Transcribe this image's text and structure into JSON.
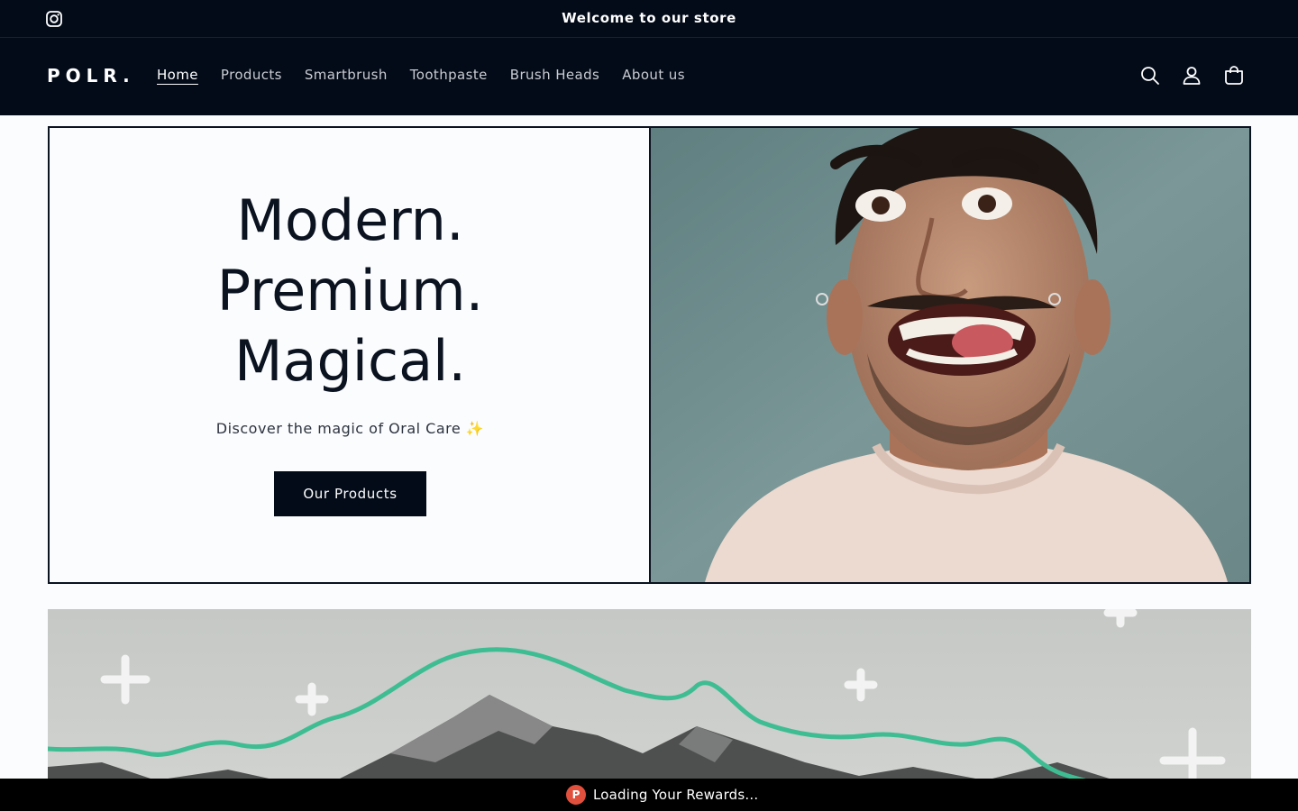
{
  "announcement": {
    "text": "Welcome to our store",
    "social_icon": "instagram-icon"
  },
  "header": {
    "logo": "POLR.",
    "nav": [
      "Home",
      "Products",
      "Smartbrush",
      "Toothpaste",
      "Brush Heads",
      "About us"
    ],
    "active_nav": "Home",
    "icons": [
      "search-icon",
      "account-icon",
      "cart-icon"
    ]
  },
  "hero": {
    "headline_lines": [
      "Modern.",
      "Premium.",
      "Magical."
    ],
    "subtitle": "Discover the magic of Oral Care ✨",
    "cta_label": "Our Products"
  },
  "rewards": {
    "icon_letter": "P",
    "text": "Loading Your Rewards..."
  },
  "colors": {
    "dark": "#030b18",
    "accent_green": "#3ebd93",
    "rewards_red": "#e0503c"
  }
}
